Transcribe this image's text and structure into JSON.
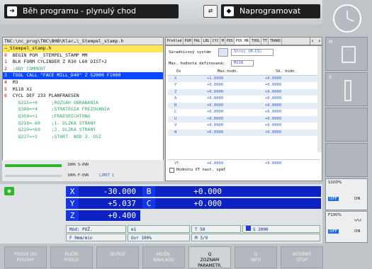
{
  "header": {
    "run_mode": "Běh programu - plynulý chod",
    "prog_mode": "Naprogramovat",
    "swap_glyph": "⇄"
  },
  "program": {
    "path": "TNC:\\nc_prog\\TNC\\BHB\\Klar…\\_Stempel_stamp.h",
    "lines": [
      {
        "n": "→",
        "t": "_Stempel_stamp.h",
        "style": "y"
      },
      {
        "n": "0",
        "t": "  BEGIN PGM _STEMPEL_STAMP MM",
        "style": ""
      },
      {
        "n": "1",
        "t": "  BLK FORM CYLINDER Z R30 L60 DIST+2",
        "style": ""
      },
      {
        "n": "2",
        "t": "  ;ANY COMMENT",
        "style": "c"
      },
      {
        "n": "3",
        "t": "  TOOL CALL \"FACE MILL_D40\" Z S2000 F1000",
        "style": "sel"
      },
      {
        "n": "4",
        "t": "  M3",
        "style": ""
      },
      {
        "n": "5",
        "t": "  M118 X1",
        "style": ""
      },
      {
        "n": "6",
        "t": "  CYCL DEF 233 PLANFRAESEN",
        "style": ""
      },
      {
        "n": "",
        "t": "     Q215=+0     ;ROZSAH OBRABANIA",
        "style": "c"
      },
      {
        "n": "",
        "t": "     Q389=+4     ;STRATEGIA FREZOVANIA",
        "style": "c"
      },
      {
        "n": "",
        "t": "     Q350=+1     ;FRAESRICHTUNG",
        "style": "c"
      },
      {
        "n": "",
        "t": "     Q218=-60    ;1. DLZKA STRANY",
        "style": "c"
      },
      {
        "n": "",
        "t": "     Q219=+60    ;2. DLZKA STRANY",
        "style": "c"
      },
      {
        "n": "",
        "t": "     Q227=+2     ;START. BOD 3. OSI",
        "style": "c"
      }
    ]
  },
  "status": {
    "s_ovr": "100% S-OVR",
    "f_ovr": "100% F-OVR",
    "limit": "LIMIT 1"
  },
  "tabs": [
    "Přehled",
    "PGM",
    "PAL",
    "LBL",
    "CYC",
    "M",
    "POS",
    "POS HR",
    "TOOL",
    "TT",
    "TRANS"
  ],
  "tab_active": "POS HR",
  "pos": {
    "coord_label": "Súradnicový systém",
    "coord_value": "Stroj (M-CS)",
    "max_label": "Max. hodnota definovaná:",
    "max_value": "M118",
    "col_os": "Os",
    "col_max": "Max.hodn.",
    "col_sk": "Sk. hodn.",
    "rows": [
      [
        "X",
        "+1.0000",
        "+0.0000"
      ],
      [
        "Y",
        "+0.0000",
        "+0.0000"
      ],
      [
        "Z",
        "+0.0000",
        "+0.0000"
      ],
      [
        "A",
        "+0.0000",
        "+0.0000"
      ],
      [
        "B",
        "+0.0000",
        "+0.0000"
      ],
      [
        "C",
        "+0.0000",
        "+0.0000"
      ],
      [
        "U",
        "+0.0000",
        "+0.0000"
      ],
      [
        "V",
        "+0.0000",
        "+0.0000"
      ],
      [
        "W",
        "+0.0000",
        "+0.0000"
      ]
    ],
    "vt": [
      "VT",
      "+0.0000",
      "+0.0000"
    ],
    "vt_reset": "Hodnotu VT nast. späť"
  },
  "axes": [
    {
      "l": "X",
      "v": "-30.000"
    },
    {
      "l": "Y",
      "v": "+5.037"
    },
    {
      "l": "Z",
      "v": "+0.400"
    }
  ],
  "axes2": [
    {
      "l": "B",
      "v": "+0.000"
    },
    {
      "l": "C",
      "v": "+0.000"
    }
  ],
  "info": {
    "mode": "Mód: POŽ.",
    "t": "T 50",
    "s": "S 2000",
    "f": "F 0mm/min",
    "ovr": "Ovr 100%",
    "m": "M 3/9"
  },
  "right_keys": {
    "m": "M",
    "s": "S",
    "s_ovr": "S100%",
    "f_ovr": "F100%",
    "off": "OFF",
    "on": "ON"
  },
  "bottom_keys": [
    "POSUV DO\nPOLOHY",
    "RUČNÍ\nPOSUV",
    "3D-ROT",
    "MOŽN.\nNÁHLADU",
    "Q\nZOZNAM\nPARAMETR.",
    "Q\nINFO",
    "INTERNÝ\nSTOP"
  ],
  "colors": {
    "axis_bg": "#0c22c2",
    "selected_line": "#0a48ff",
    "highlight": "#ffe65a",
    "off": "#1e6fd9"
  }
}
